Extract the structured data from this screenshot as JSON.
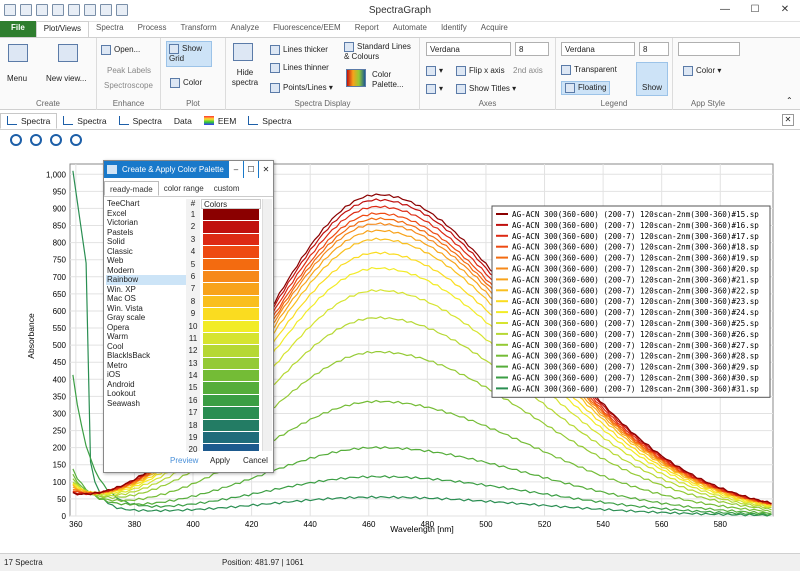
{
  "app": {
    "title": "SpectraGraph"
  },
  "window_buttons": [
    "—",
    "☐",
    "✕"
  ],
  "menu_tabs": [
    "File",
    "Plot/Views",
    "Spectra",
    "Process",
    "Transform",
    "Analyze",
    "Fluorescence/EEM",
    "Report",
    "Automate",
    "Identify",
    "Acquire"
  ],
  "ribbon": {
    "create": {
      "menu": "Menu",
      "new_view": "New view...",
      "label": "Create"
    },
    "enhance": {
      "open": "Open...",
      "peak_labels": "Peak Labels",
      "spectroscope": "Spectroscope",
      "label": "Enhance"
    },
    "plot": {
      "show_grid": "Show Grid",
      "color": "Color",
      "label": "Plot"
    },
    "spectra_display": {
      "hide_spectra": "Hide spectra",
      "lines_thicker": "Lines thicker",
      "lines_thinner": "Lines thinner",
      "points_lines": "Points/Lines",
      "standard_lines": "Standard Lines & Colours",
      "color_palette": "Color Palette...",
      "label": "Spectra Display"
    },
    "axes": {
      "font": "Verdana",
      "size": "8",
      "flip_x": "Flip x axis",
      "second_axis": "2nd axis",
      "show_titles": "Show Titles",
      "label": "Axes"
    },
    "legend": {
      "font": "Verdana",
      "size": "8",
      "transparent": "Transparent",
      "floating": "Floating",
      "show": "Show",
      "label": "Legend"
    },
    "app_style": {
      "color": "Color",
      "label": "App Style"
    }
  },
  "doc_tabs": [
    "Spectra",
    "Spectra",
    "Spectra",
    "Data",
    "EEM",
    "Spectra"
  ],
  "palette_dialog": {
    "title": "Create & Apply Color Palette",
    "tabs": [
      "ready-made",
      "color range",
      "custom"
    ],
    "palettes": [
      "TeeChart",
      "Excel",
      "Victorian",
      "Pastels",
      "Solid",
      "Classic",
      "Web",
      "Modern",
      "Rainbow",
      "Win. XP",
      "Mac OS",
      "Win. Vista",
      "Gray scale",
      "Opera",
      "Warm",
      "Cool",
      "BlacklsBack",
      "Metro",
      "iOS",
      "Android",
      "Lookout",
      "Seawash"
    ],
    "selected": "Rainbow",
    "num_header": "#",
    "colors_header": "Colors",
    "numbers": [
      "1",
      "2",
      "3",
      "4",
      "5",
      "6",
      "7",
      "8",
      "9",
      "10",
      "11",
      "12",
      "13",
      "14",
      "15",
      "16",
      "17",
      "18",
      "19",
      "20"
    ],
    "swatches": [
      "#8b0000",
      "#c0100e",
      "#dd2a14",
      "#ee4a12",
      "#f36b10",
      "#f6891a",
      "#f8a31b",
      "#f9bf1e",
      "#fadc20",
      "#f2ec26",
      "#d6e430",
      "#b6d834",
      "#94ca35",
      "#74bc36",
      "#55ad3a",
      "#3b9e44",
      "#2a8e52",
      "#237c64",
      "#1f6c7a",
      "#1d5a8e"
    ],
    "preview": "Preview",
    "apply": "Apply",
    "cancel": "Cancel"
  },
  "status": {
    "count": "17 Spectra",
    "position": "Position: 481.97  |  1061"
  },
  "chart_data": {
    "type": "line",
    "xlabel": "Wavelength [nm]",
    "ylabel": "Absorbance",
    "xlim": [
      358,
      598
    ],
    "ylim": [
      0,
      1030
    ],
    "x_ticks": [
      360,
      380,
      400,
      420,
      440,
      460,
      480,
      500,
      520,
      540,
      560,
      580
    ],
    "y_ticks": [
      0,
      50,
      100,
      150,
      200,
      250,
      300,
      350,
      400,
      450,
      500,
      550,
      600,
      650,
      700,
      750,
      800,
      850,
      900,
      950,
      1000
    ],
    "y_tick_labels": [
      "0",
      "50",
      "100",
      "150",
      "200",
      "250",
      "300",
      "350",
      "400",
      "450",
      "500",
      "550",
      "600",
      "650",
      "700",
      "750",
      "800",
      "850",
      "900",
      "950",
      "1,000"
    ],
    "grid": true,
    "legend_position": "right",
    "series": [
      {
        "name": "AG-ACN 300(360-600) (200-7) 120scan-2nm(300-360)#15.sp",
        "color": "#8b0000",
        "peak": 940,
        "start": 50
      },
      {
        "name": "AG-ACN 300(360-600) (200-7) 120scan-2nm(300-360)#16.sp",
        "color": "#c0100e",
        "peak": 925,
        "start": 50
      },
      {
        "name": "AG-ACN 300(360-600) (200-7) 120scan-2nm(300-360)#17.sp",
        "color": "#dd2a14",
        "peak": 905,
        "start": 55
      },
      {
        "name": "AG-ACN 300(360-600) (200-7) 120scan-2nm(300-360)#18.sp",
        "color": "#ee4a12",
        "peak": 885,
        "start": 60
      },
      {
        "name": "AG-ACN 300(360-600) (200-7) 120scan-2nm(300-360)#19.sp",
        "color": "#f36b10",
        "peak": 870,
        "start": 60
      },
      {
        "name": "AG-ACN 300(360-600) (200-7) 120scan-2nm(300-360)#20.sp",
        "color": "#f6891a",
        "peak": 855,
        "start": 65
      },
      {
        "name": "AG-ACN 300(360-600) (200-7) 120scan-2nm(300-360)#21.sp",
        "color": "#f8a31b",
        "peak": 835,
        "start": 70
      },
      {
        "name": "AG-ACN 300(360-600) (200-7) 120scan-2nm(300-360)#22.sp",
        "color": "#f9bf1e",
        "peak": 810,
        "start": 75
      },
      {
        "name": "AG-ACN 300(360-600) (200-7) 120scan-2nm(300-360)#23.sp",
        "color": "#fadc20",
        "peak": 770,
        "start": 80
      },
      {
        "name": "AG-ACN 300(360-600) (200-7) 120scan-2nm(300-360)#24.sp",
        "color": "#f2ec26",
        "peak": 725,
        "start": 85
      },
      {
        "name": "AG-ACN 300(360-600) (200-7) 120scan-2nm(300-360)#25.sp",
        "color": "#d6e430",
        "peak": 660,
        "start": 90
      },
      {
        "name": "AG-ACN 300(360-600) (200-7) 120scan-2nm(300-360)#26.sp",
        "color": "#b6d834",
        "peak": 580,
        "start": 95
      },
      {
        "name": "AG-ACN 300(360-600) (200-7) 120scan-2nm(300-360)#27.sp",
        "color": "#94ca35",
        "peak": 480,
        "start": 105
      },
      {
        "name": "AG-ACN 300(360-600) (200-7) 120scan-2nm(300-360)#28.sp",
        "color": "#74bc36",
        "peak": 335,
        "start": 120
      },
      {
        "name": "AG-ACN 300(360-600) (200-7) 120scan-2nm(300-360)#29.sp",
        "color": "#55ad3a",
        "peak": 200,
        "start": 140
      },
      {
        "name": "AG-ACN 300(360-600) (200-7) 120scan-2nm(300-360)#30.sp",
        "color": "#3b9e44",
        "peak": 115,
        "start": 420
      },
      {
        "name": "AG-ACN 300(360-600) (200-7) 120scan-2nm(300-360)#31.sp",
        "color": "#2a8e52",
        "peak": 55,
        "start": 1010
      }
    ]
  }
}
